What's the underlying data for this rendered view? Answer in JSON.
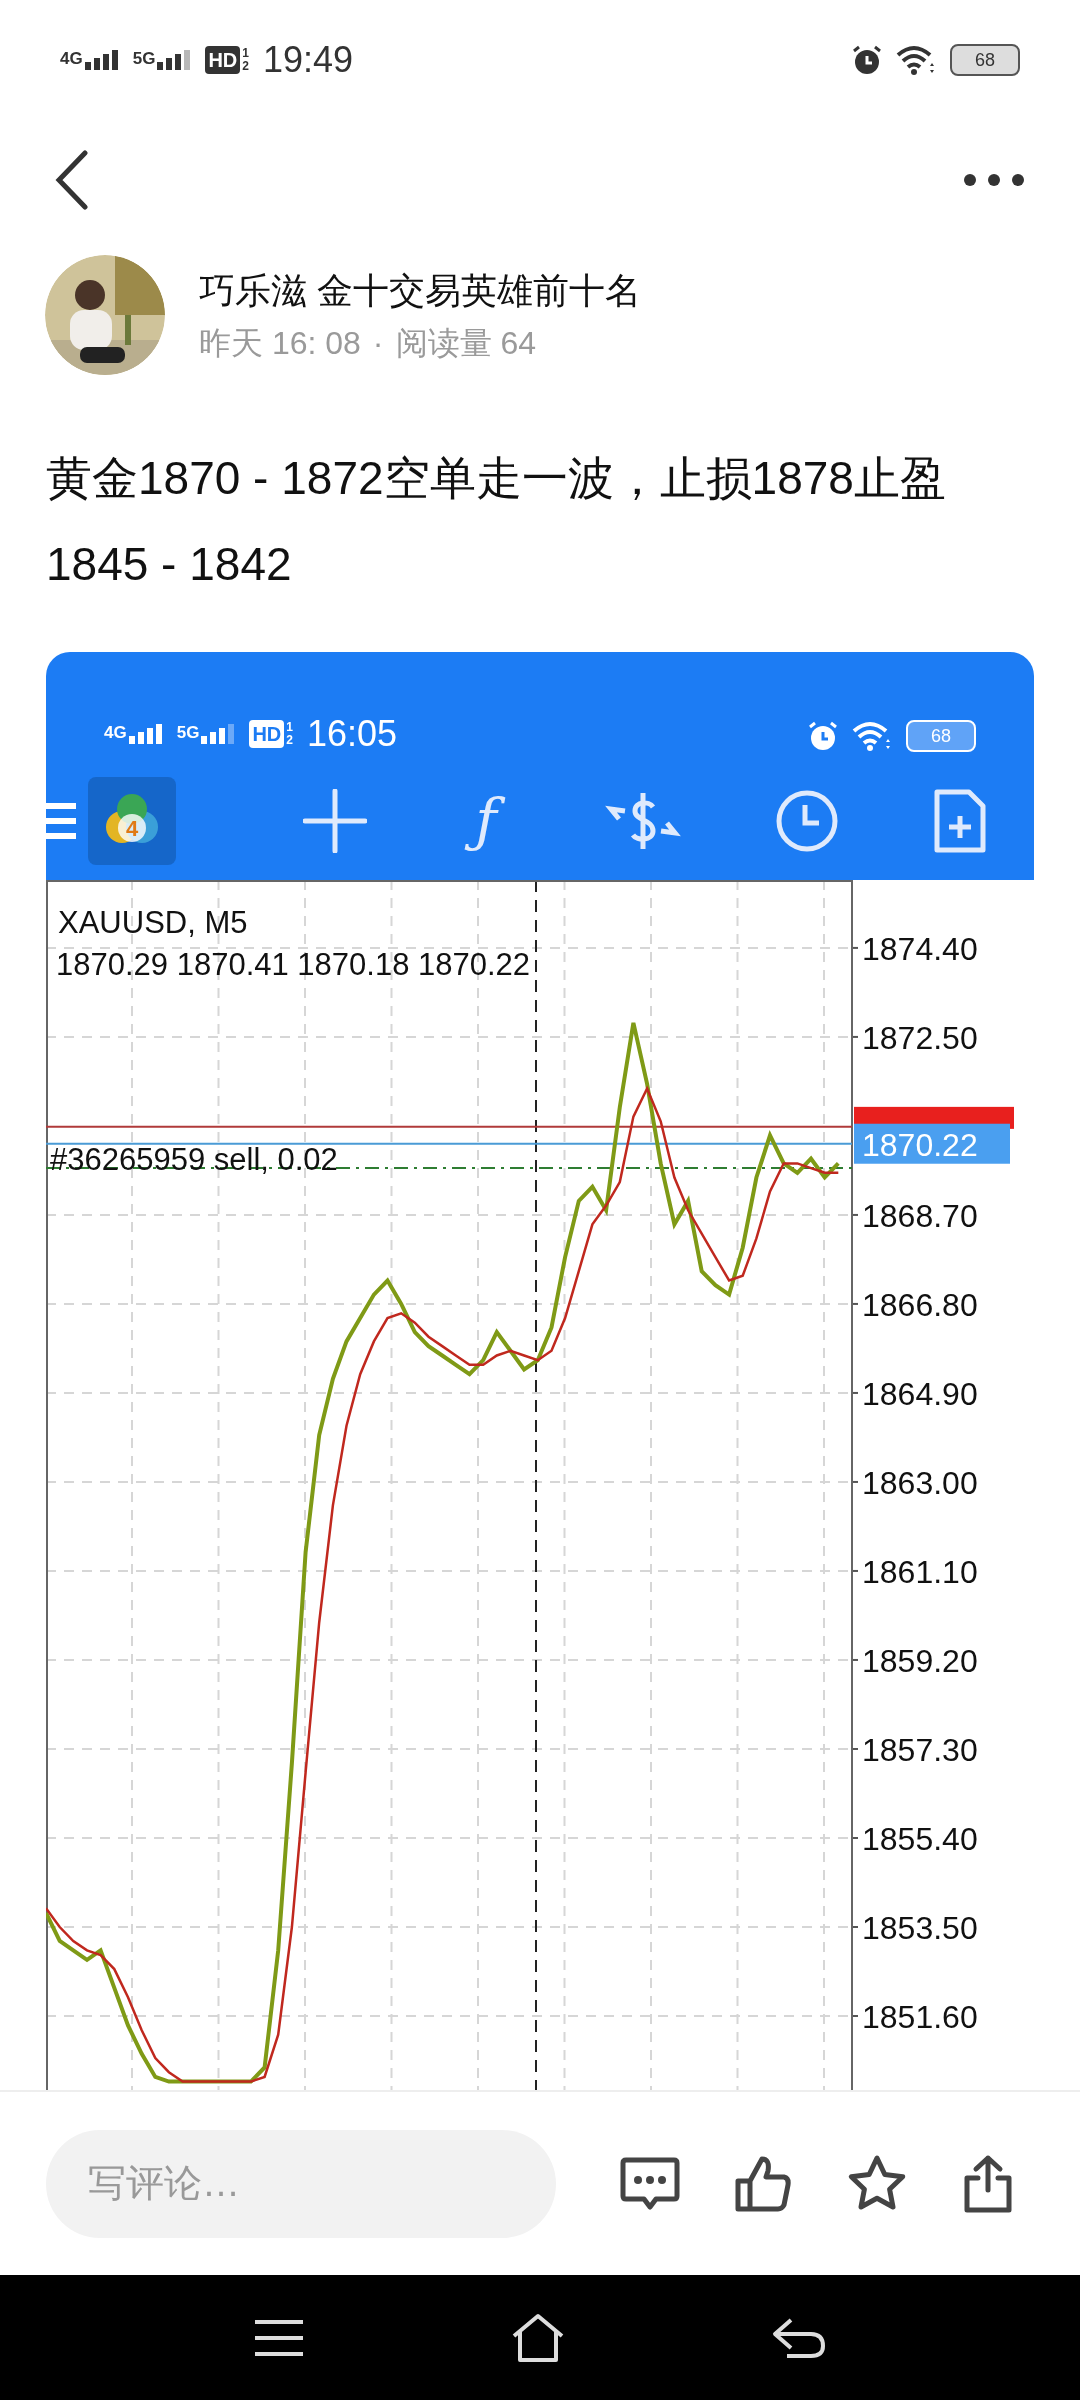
{
  "status_bar": {
    "networks": [
      "4G",
      "5G"
    ],
    "hd_badge": "HD",
    "hd_slots": [
      "1",
      "2"
    ],
    "time": "19:49",
    "battery": "68"
  },
  "post": {
    "author": "巧乐滋 金十交易英雄前十名",
    "time": "昨天 16: 08",
    "separator": "·",
    "reads": "阅读量 64",
    "text": "黄金1870 - 1872空单走一波，止损1878止盈1845 - 1842"
  },
  "screenshot": {
    "status_bar": {
      "networks": [
        "4G",
        "5G"
      ],
      "hd_badge": "HD",
      "hd_slots": [
        "1",
        "2"
      ],
      "time": "16:05",
      "battery": "68"
    },
    "toolbar": {
      "logo_digit": "4",
      "function_glyph": "ƒ"
    },
    "chart": {
      "symbol": "XAUUSD, M5",
      "ohlc": "1870.29 1870.41 1870.18 1870.22",
      "order_label": "#36265959 sell, 0.02",
      "price_tag": "1870.22",
      "chart_data": {
        "type": "line",
        "categories": [
          null,
          null,
          null,
          null,
          null,
          null,
          null,
          null,
          null,
          null,
          null,
          null,
          null,
          null,
          null,
          null,
          null,
          null,
          null,
          null,
          null,
          null,
          null,
          null,
          null,
          null,
          null,
          null,
          null,
          null,
          null,
          null,
          null,
          null,
          null,
          null,
          null,
          null,
          null,
          null,
          null,
          null,
          null,
          null,
          null,
          null,
          null,
          null,
          null,
          null,
          null,
          null,
          null,
          null,
          null,
          null,
          null,
          null,
          null
        ],
        "series": [
          {
            "color": "#7f9a16",
            "values": [
              1853.8,
              1853.2,
              1853.0,
              1852.8,
              1853.0,
              1852.2,
              1851.4,
              1850.8,
              1850.3,
              1850.2,
              1850.2,
              1850.2,
              1850.2,
              1850.2,
              1850.2,
              1850.2,
              1850.5,
              1853.0,
              1857.0,
              1861.5,
              1864.0,
              1865.2,
              1866.0,
              1866.5,
              1867.0,
              1867.3,
              1866.8,
              1866.2,
              1865.9,
              1865.7,
              1865.5,
              1865.3,
              1865.6,
              1866.2,
              1865.8,
              1865.4,
              1865.6,
              1866.3,
              1867.8,
              1869.0,
              1869.3,
              1868.8,
              1871.0,
              1872.8,
              1871.5,
              1869.8,
              1868.5,
              1869.0,
              1867.5,
              1867.2,
              1867.0,
              1868.0,
              1869.5,
              1870.4,
              1869.8,
              1869.6,
              1869.9,
              1869.5,
              1869.8
            ]
          },
          {
            "color": "#c0281e",
            "values": [
              1853.9,
              1853.5,
              1853.2,
              1853.0,
              1852.9,
              1852.6,
              1852.0,
              1851.3,
              1850.7,
              1850.4,
              1850.2,
              1850.2,
              1850.2,
              1850.2,
              1850.2,
              1850.2,
              1850.3,
              1851.2,
              1853.5,
              1856.8,
              1860.0,
              1862.5,
              1864.2,
              1865.3,
              1866.0,
              1866.5,
              1866.6,
              1866.4,
              1866.1,
              1865.9,
              1865.7,
              1865.5,
              1865.5,
              1865.7,
              1865.8,
              1865.7,
              1865.6,
              1865.8,
              1866.5,
              1867.5,
              1868.5,
              1868.9,
              1869.4,
              1870.8,
              1871.4,
              1870.7,
              1869.5,
              1868.8,
              1868.3,
              1867.8,
              1867.3,
              1867.4,
              1868.2,
              1869.2,
              1869.8,
              1869.8,
              1869.7,
              1869.6,
              1869.6
            ]
          }
        ],
        "ylim": [
          1850.02,
          1875.85
        ],
        "yticks": [
          {
            "value": 1874.4,
            "label": "1874.40"
          },
          {
            "value": 1872.5,
            "label": "1872.50"
          },
          {
            "value": 1868.7,
            "label": "1868.70"
          },
          {
            "value": 1866.8,
            "label": "1866.80"
          },
          {
            "value": 1864.9,
            "label": "1864.90"
          },
          {
            "value": 1863.0,
            "label": "1863.00"
          },
          {
            "value": 1861.1,
            "label": "1861.10"
          },
          {
            "value": 1859.2,
            "label": "1859.20"
          },
          {
            "value": 1857.3,
            "label": "1857.30"
          },
          {
            "value": 1855.4,
            "label": "1855.40"
          },
          {
            "value": 1853.5,
            "label": "1853.50"
          },
          {
            "value": 1851.6,
            "label": "1851.60"
          }
        ],
        "ref_lines": [
          {
            "axis": "y",
            "value": 1870.58,
            "color": "#b03a3a"
          },
          {
            "axis": "y",
            "value": 1870.22,
            "color": "#4a9bd6"
          },
          {
            "axis": "y",
            "value": 1869.7,
            "color": "#2e7d32"
          }
        ],
        "grid": true
      }
    }
  },
  "comment_bar": {
    "placeholder": "写评论…"
  }
}
